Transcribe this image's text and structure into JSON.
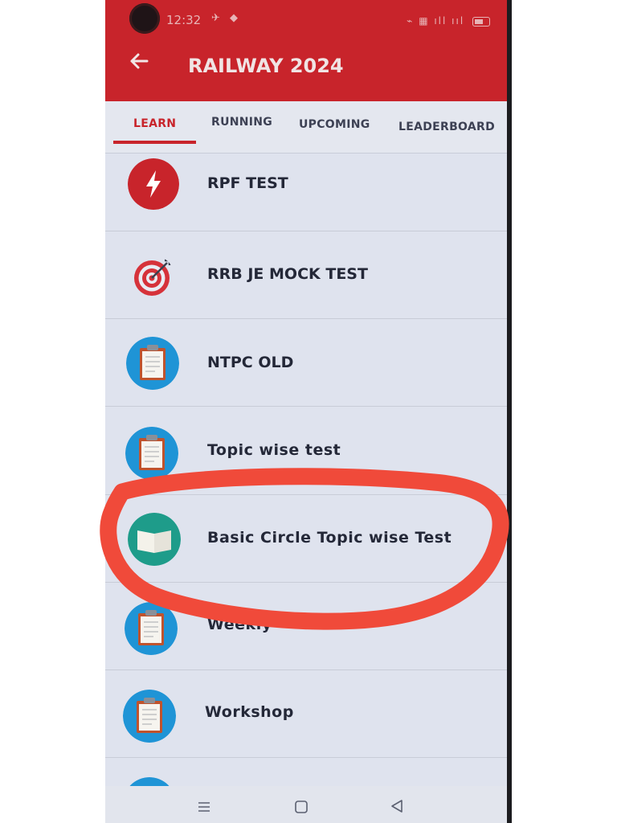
{
  "status_bar": {
    "time": "12:32",
    "left_icons": "✈ ◆",
    "right_icons": "⌁ ▦ ıll ııl"
  },
  "header": {
    "title": "RAILWAY 2024"
  },
  "tabs": [
    {
      "label": "LEARN",
      "active": true
    },
    {
      "label": "RUNNING",
      "active": false
    },
    {
      "label": "UPCOMING",
      "active": false
    },
    {
      "label": "LEADERBOARD",
      "active": false
    }
  ],
  "list": [
    {
      "label": "RPF TEST",
      "icon": "lightning-icon"
    },
    {
      "label": "RRB JE MOCK TEST",
      "icon": "target-icon"
    },
    {
      "label": "NTPC OLD",
      "icon": "clipboard-icon"
    },
    {
      "label": "Topic wise test",
      "icon": "clipboard-icon"
    },
    {
      "label": "Basic Circle Topic wise Test",
      "icon": "book-icon"
    },
    {
      "label": "Weekly",
      "icon": "clipboard-icon"
    },
    {
      "label": "Workshop",
      "icon": "clipboard-icon"
    }
  ],
  "nav_bar": {
    "icons": [
      "menu-icon",
      "home-icon",
      "back-triangle-icon"
    ]
  },
  "colors": {
    "accent": "#c8242b",
    "icon_blue": "#1f94d6",
    "annotation": "#f04a3a"
  }
}
